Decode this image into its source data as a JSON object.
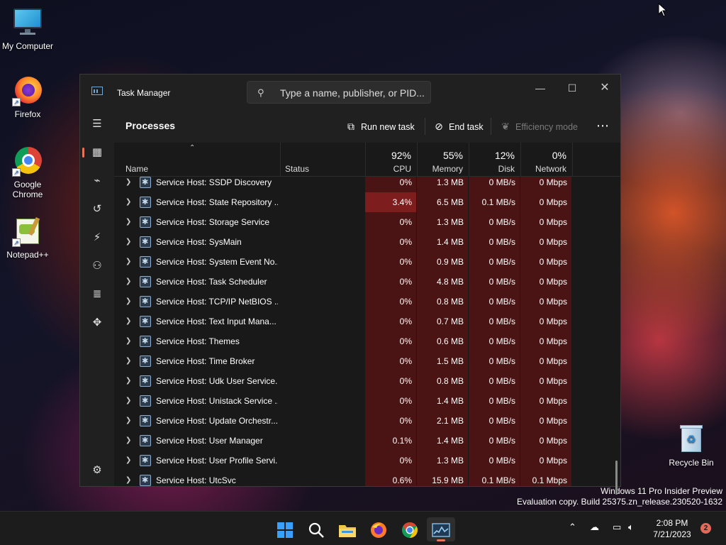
{
  "desktop": {
    "icons": [
      {
        "label": "My Computer",
        "icon": "monitor-icon"
      },
      {
        "label": "Firefox",
        "icon": "firefox-icon"
      },
      {
        "label": "Google Chrome",
        "icon": "chrome-icon"
      },
      {
        "label": "Notepad++",
        "icon": "notepadpp-icon"
      },
      {
        "label": "Recycle Bin",
        "icon": "recycle-bin-icon"
      }
    ],
    "watermark": {
      "line1": "Windows 11 Pro Insider Preview",
      "line2": "Evaluation copy. Build 25375.zn_release.230520-1632"
    }
  },
  "taskmanager": {
    "title": "Task Manager",
    "search_placeholder": "Type a name, publisher, or PID...",
    "page_title": "Processes",
    "toolbar": {
      "run_new_task": "Run new task",
      "end_task": "End task",
      "efficiency_mode": "Efficiency mode",
      "more": "⋯"
    },
    "columns": {
      "name": "Name",
      "status": "Status",
      "cpu": {
        "pct": "92%",
        "label": "CPU"
      },
      "memory": {
        "pct": "55%",
        "label": "Memory"
      },
      "disk": {
        "pct": "12%",
        "label": "Disk"
      },
      "network": {
        "pct": "0%",
        "label": "Network"
      }
    },
    "rows": [
      {
        "name": "Service Host: SSDP Discovery",
        "cpu": "0%",
        "memory": "1.3 MB",
        "disk": "0 MB/s",
        "network": "0 Mbps"
      },
      {
        "name": "Service Host: State Repository ...",
        "cpu": "3.4%",
        "memory": "6.5 MB",
        "disk": "0.1 MB/s",
        "network": "0 Mbps"
      },
      {
        "name": "Service Host: Storage Service",
        "cpu": "0%",
        "memory": "1.3 MB",
        "disk": "0 MB/s",
        "network": "0 Mbps"
      },
      {
        "name": "Service Host: SysMain",
        "cpu": "0%",
        "memory": "1.4 MB",
        "disk": "0 MB/s",
        "network": "0 Mbps"
      },
      {
        "name": "Service Host: System Event No...",
        "cpu": "0%",
        "memory": "0.9 MB",
        "disk": "0 MB/s",
        "network": "0 Mbps"
      },
      {
        "name": "Service Host: Task Scheduler",
        "cpu": "0%",
        "memory": "4.8 MB",
        "disk": "0 MB/s",
        "network": "0 Mbps"
      },
      {
        "name": "Service Host: TCP/IP NetBIOS ...",
        "cpu": "0%",
        "memory": "0.8 MB",
        "disk": "0 MB/s",
        "network": "0 Mbps"
      },
      {
        "name": "Service Host: Text Input Mana...",
        "cpu": "0%",
        "memory": "0.7 MB",
        "disk": "0 MB/s",
        "network": "0 Mbps"
      },
      {
        "name": "Service Host: Themes",
        "cpu": "0%",
        "memory": "0.6 MB",
        "disk": "0 MB/s",
        "network": "0 Mbps"
      },
      {
        "name": "Service Host: Time Broker",
        "cpu": "0%",
        "memory": "1.5 MB",
        "disk": "0 MB/s",
        "network": "0 Mbps"
      },
      {
        "name": "Service Host: Udk User Service...",
        "cpu": "0%",
        "memory": "0.8 MB",
        "disk": "0 MB/s",
        "network": "0 Mbps"
      },
      {
        "name": "Service Host: Unistack Service ...",
        "cpu": "0%",
        "memory": "1.4 MB",
        "disk": "0 MB/s",
        "network": "0 Mbps"
      },
      {
        "name": "Service Host: Update Orchestr...",
        "cpu": "0%",
        "memory": "2.1 MB",
        "disk": "0 MB/s",
        "network": "0 Mbps"
      },
      {
        "name": "Service Host: User Manager",
        "cpu": "0.1%",
        "memory": "1.4 MB",
        "disk": "0 MB/s",
        "network": "0 Mbps"
      },
      {
        "name": "Service Host: User Profile Servi...",
        "cpu": "0%",
        "memory": "1.3 MB",
        "disk": "0 MB/s",
        "network": "0 Mbps"
      },
      {
        "name": "Service Host: UtcSvc",
        "cpu": "0.6%",
        "memory": "15.9 MB",
        "disk": "0.1 MB/s",
        "network": "0.1 Mbps"
      }
    ]
  },
  "taskbar": {
    "clock_time": "2:08 PM",
    "clock_date": "7/21/2023",
    "notification_count": "2"
  },
  "colors": {
    "accent": "#e8745a",
    "heat_low": "#4a1414",
    "heat_high": "#7e1d1d"
  }
}
